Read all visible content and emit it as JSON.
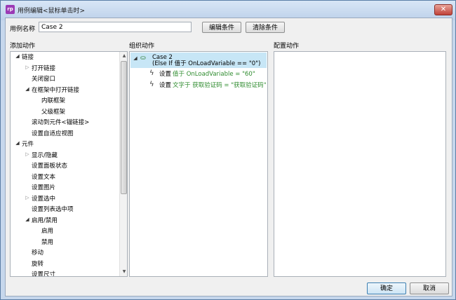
{
  "window": {
    "app_icon": "rp",
    "title": "用例编辑<鼠标单击时>",
    "close_icon": "✕"
  },
  "case_name": {
    "label": "用例名称",
    "value": "Case 2"
  },
  "buttons": {
    "edit_condition": "编辑条件",
    "clear_condition": "清除条件",
    "ok": "确定",
    "cancel": "取消"
  },
  "sections": {
    "add_action": "添加动作",
    "organize_action": "组织动作",
    "configure_action": "配置动作"
  },
  "action_tree": [
    {
      "label": "链接",
      "level": 0,
      "expander": "open"
    },
    {
      "label": "打开链接",
      "level": 1,
      "expander": "closed"
    },
    {
      "label": "关闭窗口",
      "level": 1,
      "expander": "none"
    },
    {
      "label": "在框架中打开链接",
      "level": 1,
      "expander": "open"
    },
    {
      "label": "内联框架",
      "level": 2,
      "expander": "none"
    },
    {
      "label": "父级框架",
      "level": 2,
      "expander": "none"
    },
    {
      "label": "滚动到元件<锚链接>",
      "level": 1,
      "expander": "none"
    },
    {
      "label": "设置自适应视图",
      "level": 1,
      "expander": "none"
    },
    {
      "label": "元件",
      "level": 0,
      "expander": "open"
    },
    {
      "label": "显示/隐藏",
      "level": 1,
      "expander": "closed"
    },
    {
      "label": "设置面板状态",
      "level": 1,
      "expander": "none"
    },
    {
      "label": "设置文本",
      "level": 1,
      "expander": "none"
    },
    {
      "label": "设置图片",
      "level": 1,
      "expander": "none"
    },
    {
      "label": "设置选中",
      "level": 1,
      "expander": "closed"
    },
    {
      "label": "设置列表选中项",
      "level": 1,
      "expander": "none"
    },
    {
      "label": "启用/禁用",
      "level": 1,
      "expander": "open"
    },
    {
      "label": "启用",
      "level": 2,
      "expander": "none"
    },
    {
      "label": "禁用",
      "level": 2,
      "expander": "none"
    },
    {
      "label": "移动",
      "level": 1,
      "expander": "none"
    },
    {
      "label": "旋转",
      "level": 1,
      "expander": "none"
    },
    {
      "label": "设置尺寸",
      "level": 1,
      "expander": "none"
    }
  ],
  "organize": {
    "case_title": "Case 2",
    "case_condition": "(Else If 值于 OnLoadVariable == \"0\")",
    "actions": [
      {
        "verb": "设置",
        "detail": "值于 OnLoadVariable = \"60\""
      },
      {
        "verb": "设置",
        "detail": "文字于 获取验证码 = \"获取验证码\""
      }
    ]
  },
  "colors": {
    "selection": "#c7e6f6",
    "detail_text": "#2e8b2e",
    "window_border": "#5b7ea6",
    "close_button": "#c0423a"
  }
}
